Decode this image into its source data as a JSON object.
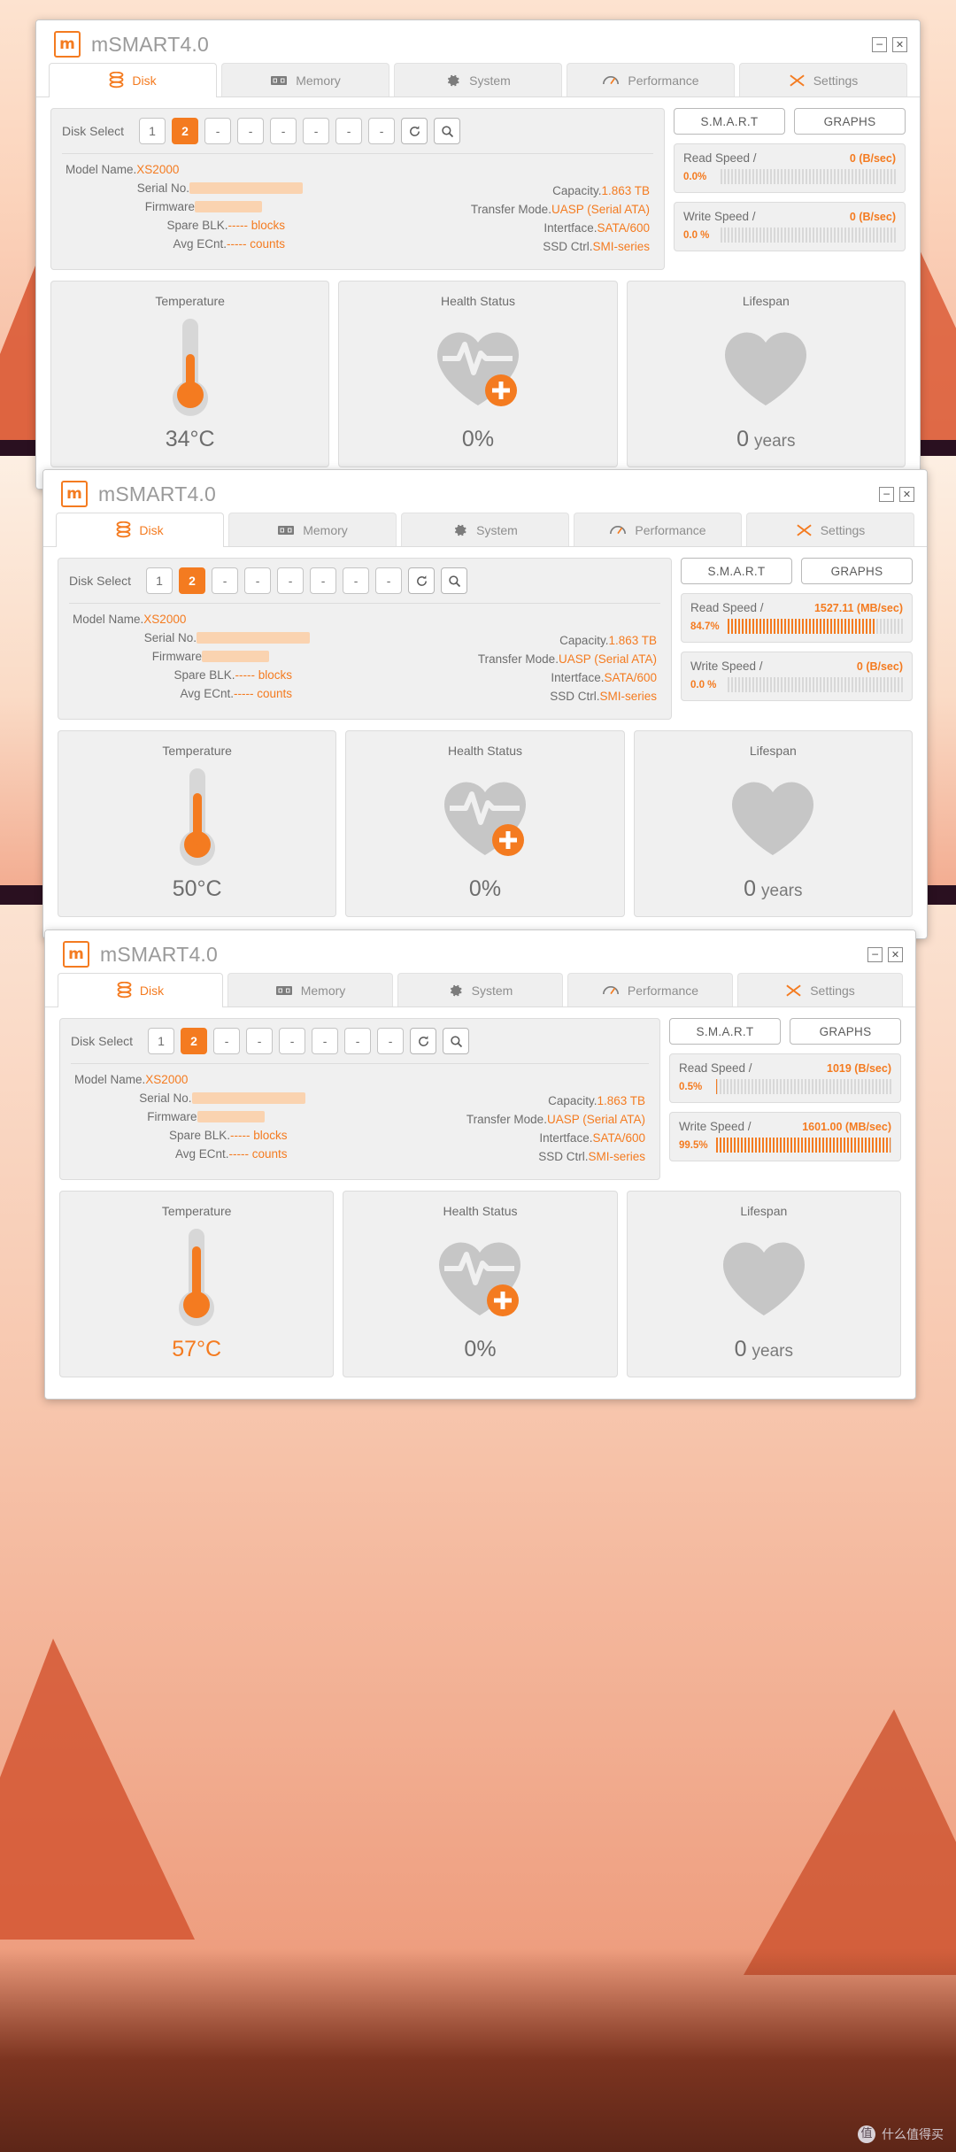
{
  "app": {
    "title": "mSMART4.0",
    "logo_glyph": "m",
    "minimize_label": "─",
    "close_label": "✕"
  },
  "tabs": [
    {
      "label": "Disk",
      "icon": "disk-icon",
      "active": true
    },
    {
      "label": "Memory",
      "icon": "memory-chip-icon",
      "active": false
    },
    {
      "label": "System",
      "icon": "gear-icon",
      "active": false
    },
    {
      "label": "Performance",
      "icon": "performance-gauge-icon",
      "active": false
    },
    {
      "label": "Settings",
      "icon": "settings-sliders-icon",
      "active": false
    }
  ],
  "disk_select": {
    "label": "Disk Select",
    "slots": [
      {
        "label": "1",
        "selected": false
      },
      {
        "label": "2",
        "selected": true
      },
      {
        "label": "-",
        "selected": false
      },
      {
        "label": "-",
        "selected": false
      },
      {
        "label": "-",
        "selected": false
      },
      {
        "label": "-",
        "selected": false
      },
      {
        "label": "-",
        "selected": false
      },
      {
        "label": "-",
        "selected": false
      }
    ],
    "refresh_icon": "refresh-icon",
    "search_icon": "search-icon"
  },
  "disk_info": {
    "left": [
      {
        "label": "Model Name.",
        "value": "XS2000",
        "redacted": false
      },
      {
        "label": "Serial No.",
        "value": "",
        "redacted": true
      },
      {
        "label": "Firmware",
        "value": "",
        "redacted": true
      },
      {
        "label": "Spare BLK.",
        "value": "----- blocks",
        "redacted": false
      },
      {
        "label": "Avg ECnt.",
        "value": "----- counts",
        "redacted": false
      }
    ],
    "right": [
      {
        "label": "Capacity.",
        "value": "1.863 TB"
      },
      {
        "label": "Transfer Mode.",
        "value": "UASP (Serial ATA)"
      },
      {
        "label": "Intertface.",
        "value": "SATA/600"
      },
      {
        "label": "SSD Ctrl.",
        "value": "SMI-series"
      }
    ]
  },
  "actions": {
    "smart_label": "S.M.A.R.T",
    "graphs_label": "GRAPHS"
  },
  "metric_titles": {
    "temperature": "Temperature",
    "health": "Health Status",
    "lifespan": "Lifespan"
  },
  "colors": {
    "accent": "#f47b20",
    "label_gray": "#6d6d6d",
    "card_bg": "#f0f0f0",
    "heart_gray": "#c6c6c6"
  },
  "panels": [
    {
      "id": "panel-1",
      "read_speed": {
        "name": "Read Speed /",
        "value": "0 (B/sec)",
        "percent_label": "0.0%",
        "percent": 0
      },
      "write_speed": {
        "name": "Write Speed /",
        "value": "0 (B/sec)",
        "percent_label": "0.0 %",
        "percent": 0
      },
      "temperature": {
        "value": "34°C",
        "hot": false,
        "fill": 0.42
      },
      "health": {
        "value": "0%"
      },
      "lifespan": {
        "value": "0",
        "unit": "years"
      }
    },
    {
      "id": "panel-2",
      "read_speed": {
        "name": "Read Speed /",
        "value": "1527.11 (MB/sec)",
        "percent_label": "84.7%",
        "percent": 84.7
      },
      "write_speed": {
        "name": "Write Speed /",
        "value": "0 (B/sec)",
        "percent_label": "0.0 %",
        "percent": 0
      },
      "temperature": {
        "value": "50°C",
        "hot": false,
        "fill": 0.62
      },
      "health": {
        "value": "0%"
      },
      "lifespan": {
        "value": "0",
        "unit": "years"
      }
    },
    {
      "id": "panel-3",
      "read_speed": {
        "name": "Read Speed /",
        "value": "1019 (B/sec)",
        "percent_label": "0.5%",
        "percent": 0.5
      },
      "write_speed": {
        "name": "Write Speed /",
        "value": "1601.00 (MB/sec)",
        "percent_label": "99.5%",
        "percent": 99.5
      },
      "temperature": {
        "value": "57°C",
        "hot": true,
        "fill": 0.72
      },
      "health": {
        "value": "0%"
      },
      "lifespan": {
        "value": "0",
        "unit": "years"
      }
    }
  ],
  "watermark": {
    "badge": "值",
    "text": "什么值得买"
  }
}
